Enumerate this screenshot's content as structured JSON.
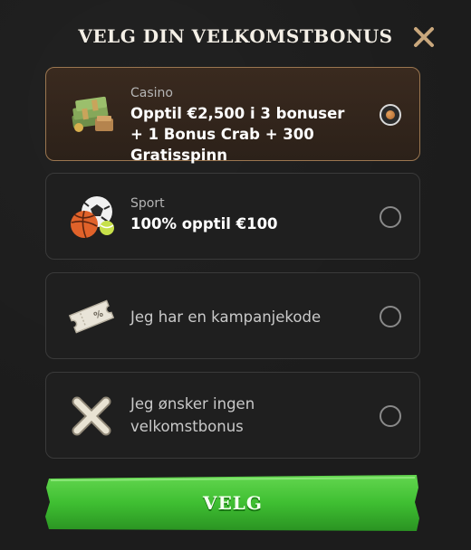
{
  "header": {
    "title": "VELG DIN VELKOMSTBONUS",
    "close_icon": "close-x-icon"
  },
  "options": [
    {
      "category": "Casino",
      "description": "Opptil €2,500 i 3 bonuser + 1 Bonus Crab + 300 Gratisspinn",
      "icon": "cash-stack-icon",
      "selected": true
    },
    {
      "category": "Sport",
      "description": "100% opptil €100",
      "icon": "sports-balls-icon",
      "selected": false
    },
    {
      "category": "",
      "description": "Jeg har en kampanjekode",
      "icon": "coupon-ticket-icon",
      "selected": false
    },
    {
      "category": "",
      "description": "Jeg ønsker ingen velkomstbonus",
      "icon": "no-bonus-x-icon",
      "selected": false
    }
  ],
  "cta": {
    "label": "VELG"
  },
  "colors": {
    "accent_green": "#3fbf32",
    "selected_border": "#9a7650",
    "background": "#1c1c1c"
  }
}
